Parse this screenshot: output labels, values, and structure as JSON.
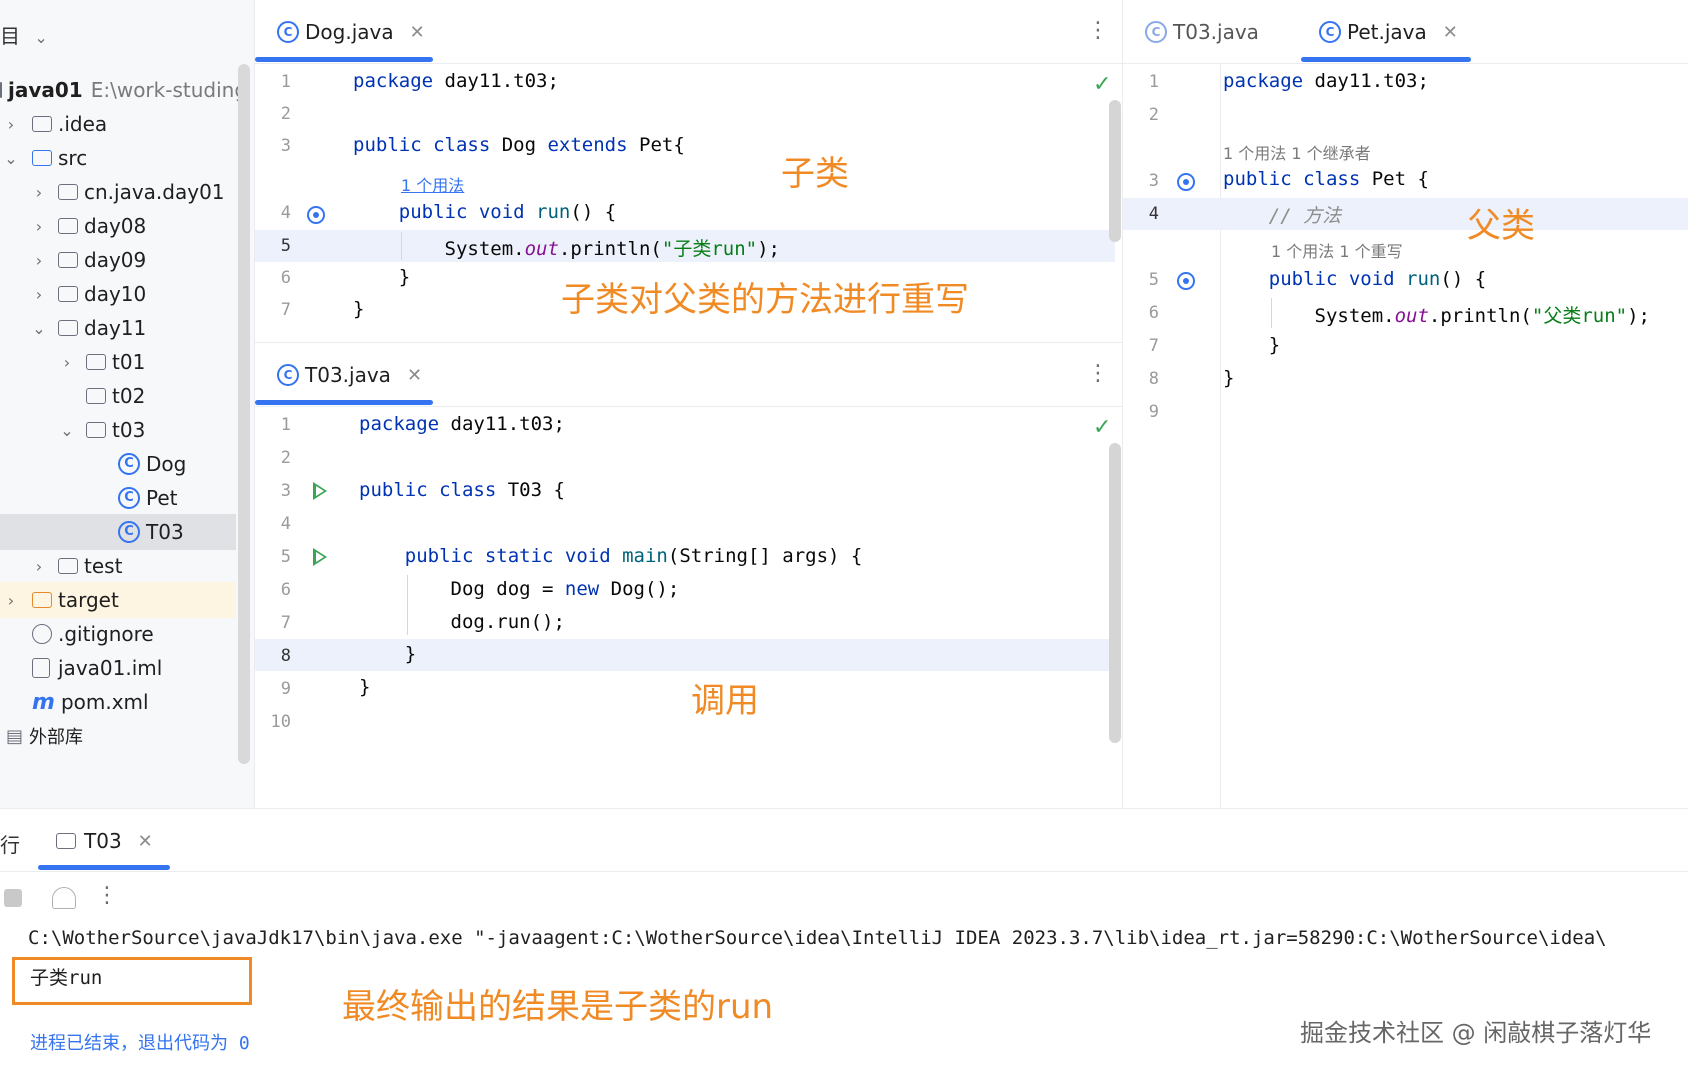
{
  "project": {
    "header_glyph": "目",
    "root": {
      "name": "java01",
      "path": "E:\\work-studing"
    },
    "items": [
      {
        "label": ".idea"
      },
      {
        "label": "src"
      },
      {
        "label": "cn.java.day01"
      },
      {
        "label": "day08"
      },
      {
        "label": "day09"
      },
      {
        "label": "day10"
      },
      {
        "label": "day11"
      },
      {
        "label": "t01"
      },
      {
        "label": "t02"
      },
      {
        "label": "t03"
      },
      {
        "label": "Dog"
      },
      {
        "label": "Pet"
      },
      {
        "label": "T03"
      },
      {
        "label": "test"
      },
      {
        "label": "target"
      },
      {
        "label": ".gitignore"
      },
      {
        "label": "java01.iml"
      },
      {
        "label": "pom.xml"
      },
      {
        "label": "外部库"
      }
    ]
  },
  "dog_editor": {
    "tab": "Dog.java",
    "lines": [
      "1",
      "2",
      "3",
      "4",
      "5",
      "6",
      "7"
    ],
    "code": {
      "l1_kw": "package",
      "l1_rest": " day11.t03;",
      "l3_kw": "public class",
      "l3_name": " Dog ",
      "l3_kw2": "extends",
      "l3_rest": " Pet{",
      "hint_usage": "1 个用法",
      "l4_kw": "public void",
      "l4_fn": " run",
      "l4_rest": "() {",
      "l5_a": "System.",
      "l5_out": "out",
      "l5_b": ".println(",
      "l5_str": "\"子类run\"",
      "l5_c": ");",
      "l6": "}",
      "l7": "}"
    },
    "ann_subclass": "子类",
    "ann_override": "子类对父类的方法进行重写"
  },
  "t03_editor": {
    "tab": "T03.java",
    "lines": [
      "1",
      "2",
      "3",
      "4",
      "5",
      "6",
      "7",
      "8",
      "9",
      "10"
    ],
    "code": {
      "l1_kw": "package",
      "l1_rest": " day11.t03;",
      "l3_kw": "public class",
      "l3_rest": " T03 {",
      "l5_kw": "public static void",
      "l5_fn": " main",
      "l5_rest": "(String[] args) {",
      "l6_a": "Dog dog = ",
      "l6_kw": "new",
      "l6_b": " Dog();",
      "l7": "dog.run();",
      "l8": "}",
      "l9": "}"
    },
    "ann_call": "调用"
  },
  "pet_editor": {
    "tab_inactive": "T03.java",
    "tab": "Pet.java",
    "lines": [
      "1",
      "2",
      "3",
      "4",
      "5",
      "6",
      "7",
      "8",
      "9"
    ],
    "code": {
      "l1_kw": "package",
      "l1_rest": " day11.t03;",
      "hint_class": "1 个用法    1 个继承者",
      "l3_kw": "public class",
      "l3_rest": " Pet {",
      "l4_cmt": "// 方法",
      "hint_method": "1 个用法    1 个重写",
      "l5_kw": "public void",
      "l5_fn": " run",
      "l5_rest": "() {",
      "l6_a": "System.",
      "l6_out": "out",
      "l6_b": ".println(",
      "l6_str": "\"父类run\"",
      "l6_c": ");",
      "l7": "}",
      "l8": "}"
    },
    "ann_parent": "父类"
  },
  "run_panel": {
    "side_label": "行",
    "tab": "T03",
    "command": "C:\\WotherSource\\javaJdk17\\bin\\java.exe \"-javaagent:C:\\WotherSource\\idea\\IntelliJ IDEA 2023.3.7\\lib\\idea_rt.jar=58290:C:\\WotherSource\\idea\\",
    "output": "子类run",
    "exit": "进程已结束，退出代码为 0",
    "ann_result": "最终输出的结果是子类的run",
    "watermark": "掘金技术社区 @ 闲敲棋子落灯华"
  }
}
